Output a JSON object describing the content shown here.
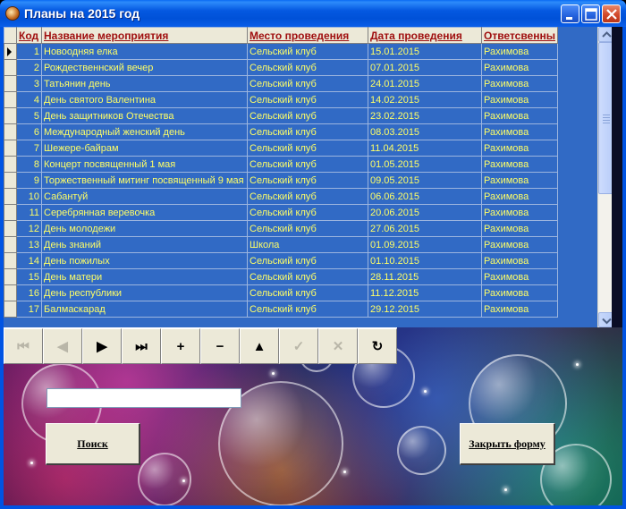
{
  "window": {
    "title": "Планы на 2015 год"
  },
  "grid": {
    "columns": [
      "Код",
      "Название  мероприятия",
      "Место  проведения",
      "Дата  проведения",
      "Ответсвенны"
    ],
    "rows": [
      [
        "1",
        "Новоодняя елка",
        "Сельский клуб",
        "15.01.2015",
        "Рахимова"
      ],
      [
        "2",
        "Рождественнский вечер",
        "Сельский клуб",
        "07.01.2015",
        "Рахимова"
      ],
      [
        "3",
        "Татьянин день",
        "Сельский клуб",
        "24.01.2015",
        "Рахимова"
      ],
      [
        "4",
        "День святого Валентина",
        "Сельский клуб",
        "14.02.2015",
        "Рахимова"
      ],
      [
        "5",
        "День защитников Отечества",
        "Сельский клуб",
        "23.02.2015",
        "Рахимова"
      ],
      [
        "6",
        "Международный женский день",
        "Сельский клуб",
        "08.03.2015",
        "Рахимова"
      ],
      [
        "7",
        "Шежере-байрам",
        "Сельский клуб",
        "11.04.2015",
        "Рахимова"
      ],
      [
        "8",
        "Концерт посвященный 1 мая",
        "Сельский клуб",
        "01.05.2015",
        "Рахимова"
      ],
      [
        "9",
        "Торжественный митинг посвященный 9 мая",
        "Сельский клуб",
        "09.05.2015",
        "Рахимова"
      ],
      [
        "10",
        "Сабантуй",
        "Сельский клуб",
        "06.06.2015",
        "Рахимова"
      ],
      [
        "11",
        "Серебрянная веревочка",
        "Сельский клуб",
        "20.06.2015",
        "Рахимова"
      ],
      [
        "12",
        "День молодежи",
        "Сельский клуб",
        "27.06.2015",
        "Рахимова"
      ],
      [
        "13",
        "День знаний",
        "Школа",
        "01.09.2015",
        "Рахимова"
      ],
      [
        "14",
        "День пожилых",
        "Сельский клуб",
        "01.10.2015",
        "Рахимова"
      ],
      [
        "15",
        "День матери",
        "Сельский клуб",
        "28.11.2015",
        "Рахимова"
      ],
      [
        "16",
        "День республики",
        "Сельский клуб",
        "11.12.2015",
        "Рахимова"
      ],
      [
        "17",
        "Балмаскарад",
        "Сельский клуб",
        "29.12.2015",
        "Рахимова"
      ]
    ],
    "selected_row": 1
  },
  "navigator": {
    "buttons": [
      {
        "name": "nav-first-button",
        "glyph": "⏮",
        "disabled": true
      },
      {
        "name": "nav-prior-button",
        "glyph": "◀",
        "disabled": true
      },
      {
        "name": "nav-next-button",
        "glyph": "▶",
        "disabled": false
      },
      {
        "name": "nav-last-button",
        "glyph": "⏭",
        "disabled": false
      },
      {
        "name": "nav-insert-button",
        "glyph": "+",
        "disabled": false
      },
      {
        "name": "nav-delete-button",
        "glyph": "−",
        "disabled": false
      },
      {
        "name": "nav-edit-button",
        "glyph": "▲",
        "disabled": false
      },
      {
        "name": "nav-post-button",
        "glyph": "✓",
        "disabled": true
      },
      {
        "name": "nav-cancel-button",
        "glyph": "✕",
        "disabled": true
      },
      {
        "name": "nav-refresh-button",
        "glyph": "↻",
        "disabled": false
      }
    ]
  },
  "search": {
    "value": "",
    "button_label": "Поиск"
  },
  "close_form": {
    "button_label": "Закрыть форму"
  },
  "colors": {
    "grid_background": "#316ac5",
    "grid_text": "#ffff66",
    "header_text": "#a01010",
    "window_frame": "#0054e3"
  }
}
